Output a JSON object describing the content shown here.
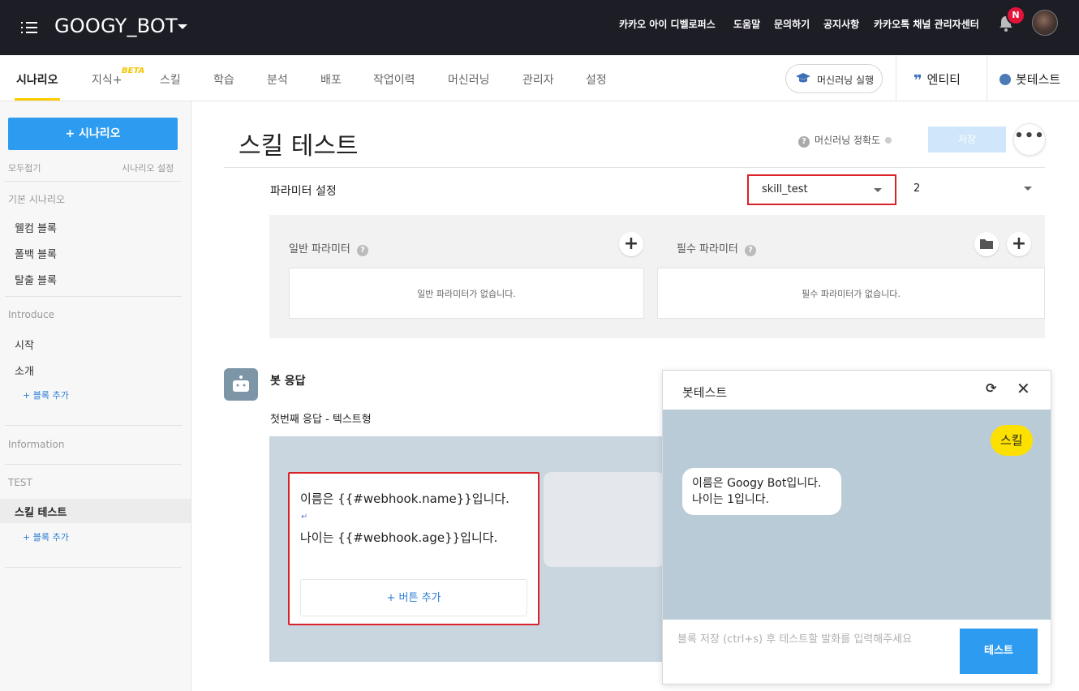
{
  "topbar": {
    "bot_name": "GOOGY_BOT",
    "links": [
      "카카오 아이 디벨로퍼스",
      "도움말",
      "문의하기",
      "공지사항",
      "카카오톡 채널 관리자센터"
    ],
    "notification_badge": "N"
  },
  "nav": {
    "tabs": [
      "시나리오",
      "지식+",
      "스킬",
      "학습",
      "분석",
      "배포",
      "작업이력",
      "머신러닝",
      "관리자",
      "설정"
    ],
    "beta": "BETA",
    "ml_run": "머신러닝 실행",
    "entity": "엔티티",
    "bot_test": "봇테스트"
  },
  "sidebar": {
    "add_button": "+ 시나리오",
    "collapse_all": "모두접기",
    "scenario_settings": "시나리오 설정",
    "sections": [
      {
        "title": "기본 시나리오",
        "items": [
          "웰컴 블록",
          "폴백 블록",
          "탈출 블록"
        ]
      },
      {
        "title": "Introduce",
        "items": [
          "시작",
          "소개"
        ],
        "add": "+ 블록 추가"
      },
      {
        "title": "Information",
        "items": []
      },
      {
        "title": "TEST",
        "items": [
          "스킬 테스트"
        ],
        "add": "+ 블록 추가"
      }
    ]
  },
  "main": {
    "title": "스킬 테스트",
    "ml_accuracy": "머신러닝 정확도",
    "save": "저장",
    "more": "•••",
    "param_settings": "파라미터 설정",
    "skill_select": "skill_test",
    "version_select": "2",
    "general_params": "일반 파라미터",
    "required_params": "필수 파라미터",
    "general_empty": "일반 파라미터가 없습니다.",
    "required_empty": "필수 파라미터가 없습니다.",
    "bot_response": "봇 응답",
    "first_response": "첫번째 응답 - 텍스트형",
    "response_line1": "이름은 {{#webhook.name}}입니다.",
    "response_line2": "나이는 {{#webhook.age}}입니다.",
    "add_button": "+ 버튼 추가"
  },
  "bottest": {
    "title": "봇테스트",
    "user_message": "스킬",
    "bot_line1": "이름은 Googy Bot입니다.",
    "bot_line2": "나이는 1입니다.",
    "input_placeholder": "블록 저장 (ctrl+s) 후 테스트할 발화를 입력해주세요",
    "send": "테스트"
  },
  "colors": {
    "topbar": "#1d1d26",
    "accent_blue": "#2d9cf0",
    "highlight_red": "#d9222a",
    "user_bubble": "#fce000",
    "nav_underline": "#ffcd00"
  }
}
